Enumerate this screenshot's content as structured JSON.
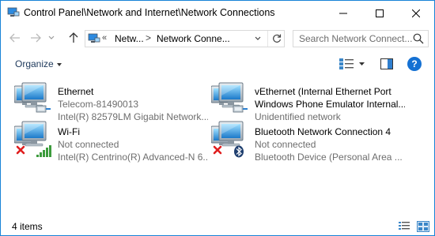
{
  "window": {
    "title": "Control Panel\\Network and Internet\\Network Connections",
    "accent": "#1883d7"
  },
  "address": {
    "chevron": "«",
    "segment1": "Netw...",
    "separator": ">",
    "segment2": "Network Conne..."
  },
  "search": {
    "placeholder": "Search Network Connect..."
  },
  "toolbar": {
    "organize_label": "Organize",
    "help_label": "?"
  },
  "connections": [
    {
      "name": "Ethernet",
      "status": "Telecom-81490013",
      "device": "Intel(R) 82579LM Gigabit Network...",
      "icon": "ethernet-connected-icon"
    },
    {
      "name": "vEthernet (Internal Ethernet Port",
      "status": "Windows Phone Emulator Internal...",
      "device": "Unidentified network",
      "icon": "ethernet-connected-icon"
    },
    {
      "name": "Wi-Fi",
      "status": "Not connected",
      "device": "Intel(R) Centrino(R) Advanced-N 6...",
      "icon": "wifi-disconnected-icon"
    },
    {
      "name": "Bluetooth Network Connection 4",
      "status": "Not connected",
      "device": "Bluetooth Device (Personal Area ...",
      "icon": "bluetooth-disconnected-icon"
    }
  ],
  "statusbar": {
    "item_count": "4 items"
  }
}
